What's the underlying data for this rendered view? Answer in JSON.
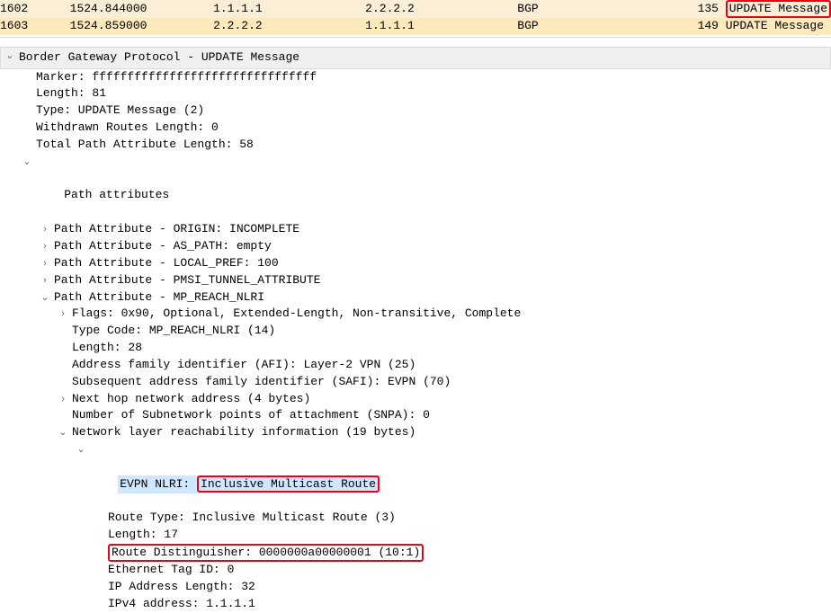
{
  "packet_list": {
    "rows": [
      {
        "no": "1602",
        "time": "1524.844000",
        "source": "1.1.1.1",
        "dest": "2.2.2.2",
        "proto": "BGP",
        "len": "135",
        "info": "UPDATE Message"
      },
      {
        "no": "1603",
        "time": "1524.859000",
        "source": "2.2.2.2",
        "dest": "1.1.1.1",
        "proto": "BGP",
        "len": "149",
        "info": "UPDATE Message"
      }
    ]
  },
  "bgp": {
    "header": "Border Gateway Protocol - UPDATE Message",
    "marker": "Marker: ffffffffffffffffffffffffffffffff",
    "length": "Length: 81",
    "type": "Type: UPDATE Message (2)",
    "withdrawn": "Withdrawn Routes Length: 0",
    "tpal": "Total Path Attribute Length: 58",
    "pa_header": "Path attributes",
    "pa": {
      "origin": "Path Attribute - ORIGIN: INCOMPLETE",
      "aspath": "Path Attribute - AS_PATH: empty",
      "localpref": "Path Attribute - LOCAL_PREF: 100",
      "pmsi": "Path Attribute - PMSI_TUNNEL_ATTRIBUTE",
      "mpreach": "Path Attribute - MP_REACH_NLRI"
    },
    "mp": {
      "flags": "Flags: 0x90, Optional, Extended-Length, Non-transitive, Complete",
      "tc": "Type Code: MP_REACH_NLRI (14)",
      "len": "Length: 28",
      "afi": "Address family identifier (AFI): Layer-2 VPN (25)",
      "safi": "Subsequent address family identifier (SAFI): EVPN (70)",
      "nexthop": "Next hop network address (4 bytes)",
      "snpa": "Number of Subnetwork points of attachment (SNPA): 0",
      "nlri": "Network layer reachability information (19 bytes)",
      "evpn_nlri_prefix": "EVPN NLRI: ",
      "evpn_nlri_value": "Inclusive Multicast Route",
      "evpn": {
        "rt": "Route Type: Inclusive Multicast Route (3)",
        "len": "Length: 17",
        "rd": "Route Distinguisher: 0000000a00000001 (10:1)",
        "etag": "Ethernet Tag ID: 0",
        "iplen": "IP Address Length: 32",
        "ipv4": "IPv4 address: 1.1.1.1"
      }
    }
  }
}
